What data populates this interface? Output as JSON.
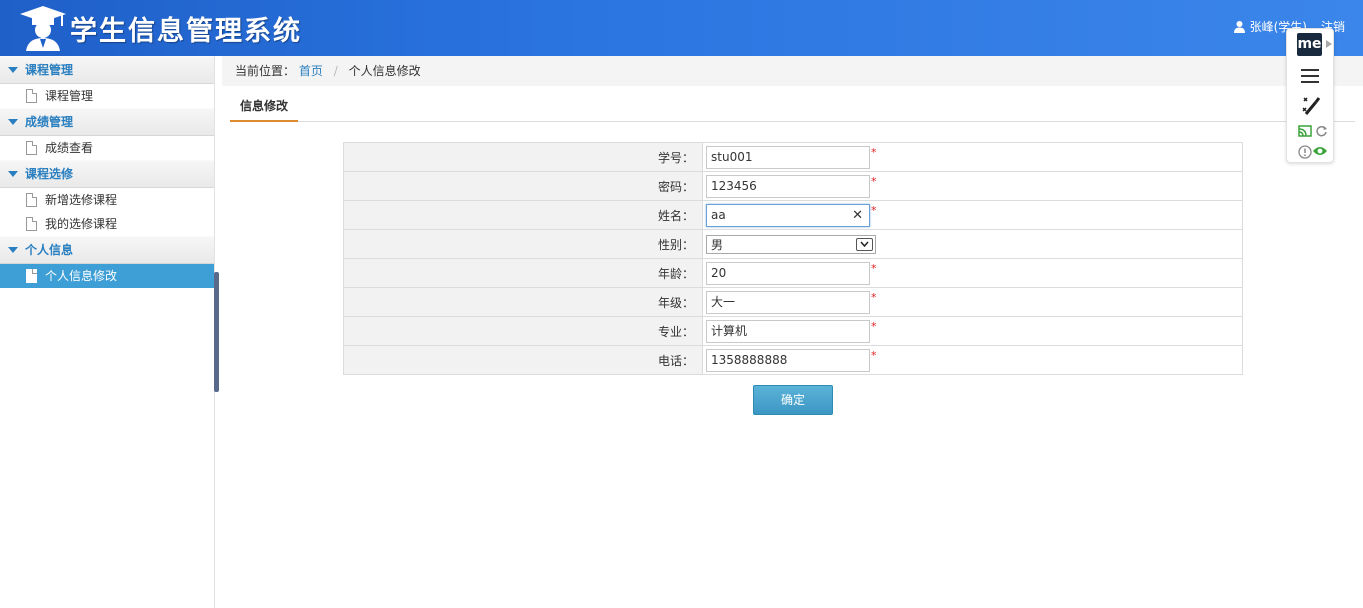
{
  "header": {
    "title": "学生信息管理系统",
    "user": "张峰(学生)",
    "logout": "注销"
  },
  "sidebar": {
    "groups": [
      {
        "title": "课程管理",
        "items": [
          {
            "label": "课程管理"
          }
        ]
      },
      {
        "title": "成绩管理",
        "items": [
          {
            "label": "成绩查看"
          }
        ]
      },
      {
        "title": "课程选修",
        "items": [
          {
            "label": "新增选修课程"
          },
          {
            "label": "我的选修课程"
          }
        ]
      },
      {
        "title": "个人信息",
        "items": [
          {
            "label": "个人信息修改"
          }
        ]
      }
    ]
  },
  "breadcrumb": {
    "prefix": "当前位置：",
    "home": "首页",
    "separator": "/",
    "current": "个人信息修改"
  },
  "tab": {
    "label": "信息修改"
  },
  "form": {
    "fields": [
      {
        "label": "学号：",
        "value": "stu001"
      },
      {
        "label": "密码：",
        "value": "123456"
      },
      {
        "label": "姓名：",
        "value": "aa"
      },
      {
        "label": "性别：",
        "value": "男"
      },
      {
        "label": "年龄：",
        "value": "20"
      },
      {
        "label": "年级：",
        "value": "大一"
      },
      {
        "label": "专业：",
        "value": "计算机"
      },
      {
        "label": "电话：",
        "value": "1358888888"
      }
    ],
    "required_mark": "*",
    "clear_glyph": "✕",
    "submit": "确定"
  },
  "toolbar": {
    "me_label": "me"
  },
  "colors": {
    "header_start": "#1f5fc8",
    "header_end": "#3b86ea",
    "link": "#2a7fc0",
    "active_menu": "#3e9fd6",
    "tab_underline": "#e08a2e",
    "required": "#e02020"
  }
}
